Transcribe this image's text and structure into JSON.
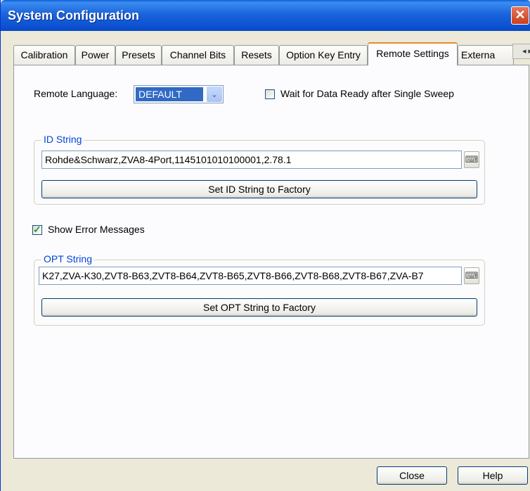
{
  "window": {
    "title": "System Configuration",
    "close_glyph": "✕"
  },
  "tabs": [
    {
      "label": "Calibration"
    },
    {
      "label": "Power"
    },
    {
      "label": "Presets"
    },
    {
      "label": "Channel Bits"
    },
    {
      "label": "Resets"
    },
    {
      "label": "Option Key Entry"
    },
    {
      "label": "Remote Settings",
      "active": true
    },
    {
      "label": "Externa"
    }
  ],
  "tab_scroll": {
    "left": "◂",
    "right": "▸"
  },
  "remote": {
    "language_label": "Remote Language:",
    "language_value": "DEFAULT",
    "dropdown_glyph": "⌄",
    "wait_label": "Wait for Data Ready after Single Sweep",
    "wait_checked": false
  },
  "id_group": {
    "title": "ID String",
    "value": "Rohde&Schwarz,ZVA8-4Port,1145101010100001,2.78.1",
    "keyboard_glyph": "⌨",
    "reset_label": "Set ID String to Factory"
  },
  "errors": {
    "label": "Show  Error Messages",
    "checked": true
  },
  "opt_group": {
    "title": "OPT String",
    "value": "K27,ZVA-K30,ZVT8-B63,ZVT8-B64,ZVT8-B65,ZVT8-B66,ZVT8-B68,ZVT8-B67,ZVA-B7",
    "keyboard_glyph": "⌨",
    "reset_label": "Set OPT String to Factory"
  },
  "footer": {
    "close_label": "Close",
    "help_label": "Help"
  },
  "colors": {
    "title_bar": "#1a64dc",
    "active_tab_accent": "#e68b2c",
    "group_title": "#0046d5",
    "selection": "#316ac5"
  }
}
